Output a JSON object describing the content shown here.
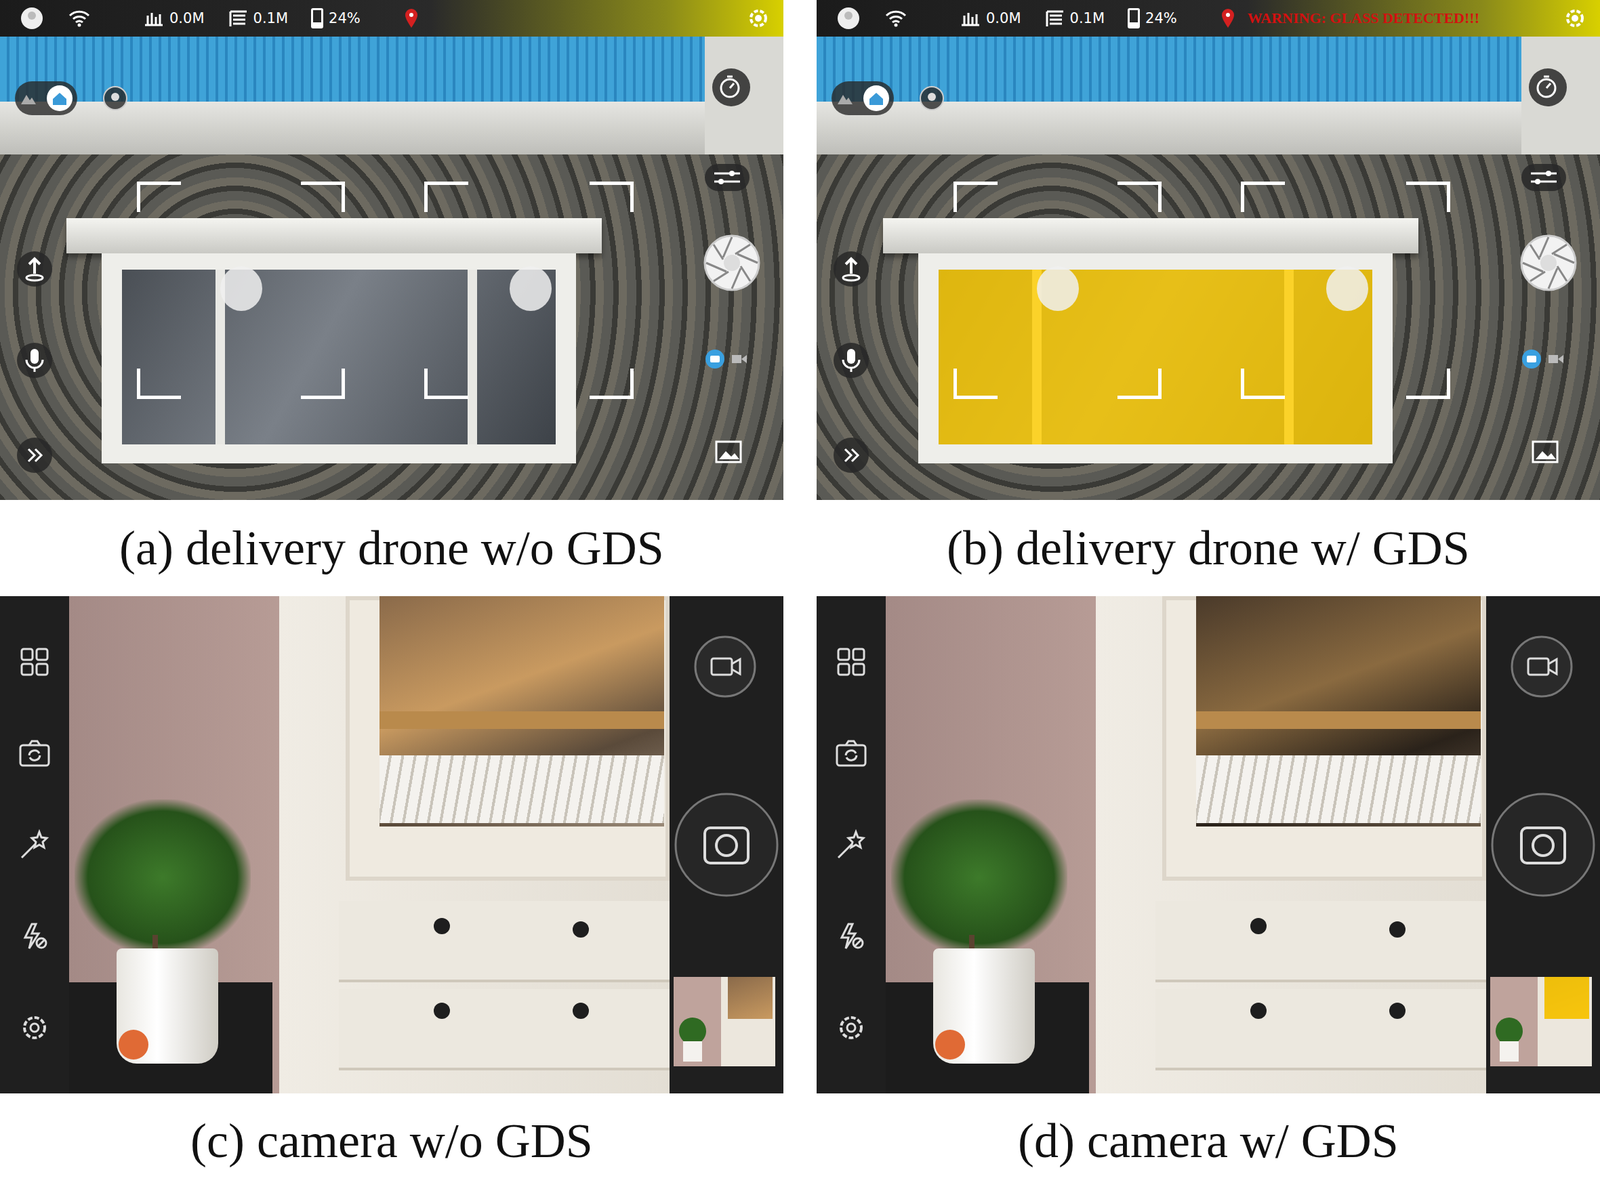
{
  "figure": {
    "panels": [
      {
        "kind": "drone",
        "caption": "(a) delivery drone w/o GDS",
        "glass_highlighted": false,
        "status": {
          "distance": "0.0M",
          "height": "0.1M",
          "battery": "24%",
          "battery_level": 0.24
        }
      },
      {
        "kind": "drone",
        "caption": "(b) delivery drone w/ GDS",
        "glass_highlighted": true,
        "status": {
          "distance": "0.0M",
          "height": "0.1M",
          "battery": "24%",
          "battery_level": 0.24,
          "warning": "WARNING: GLASS DETECTED!!!"
        }
      },
      {
        "kind": "camera",
        "caption": "(c) camera w/o GDS",
        "glass_highlighted": false
      },
      {
        "kind": "camera",
        "caption": "(d) camera w/ GDS",
        "glass_highlighted": true
      }
    ]
  }
}
